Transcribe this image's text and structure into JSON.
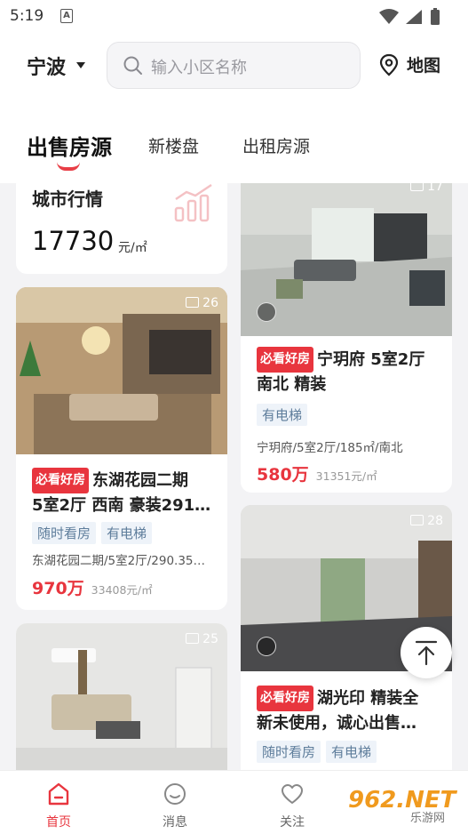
{
  "status_bar": {
    "time": "5:19"
  },
  "header": {
    "city": "宁波",
    "search_placeholder": "输入小区名称",
    "map_label": "地图",
    "tabs": [
      {
        "label": "出售房源",
        "active": true
      },
      {
        "label": "新楼盘",
        "active": false
      },
      {
        "label": "出租房源",
        "active": false
      }
    ]
  },
  "market": {
    "title": "城市行情",
    "price": "17730",
    "unit": "元/㎡"
  },
  "listings": [
    {
      "photo_count": "17",
      "badge": "必看好房",
      "title": "宁玥府 5室2厅南北 精装",
      "title_line1": "宁玥府 5室2厅",
      "title_line2": "南北 精装",
      "tags": [
        "有电梯"
      ],
      "meta": "宁玥府/5室2厅/185㎡/南北",
      "price": "580万",
      "unit_price": "31351元/㎡"
    },
    {
      "photo_count": "26",
      "badge": "必看好房",
      "title_line1": "东湖花园二期",
      "title_line2": "5室2厅 西南 豪装291…",
      "tags": [
        "随时看房",
        "有电梯"
      ],
      "meta": "东湖花园二期/5室2厅/290.35…",
      "price": "970万",
      "unit_price": "33408元/㎡"
    },
    {
      "photo_count": "28",
      "badge": "必看好房",
      "title_line1": "湖光印 精装全",
      "title_line2": "新未使用，诚心出售…",
      "tags": [
        "随时看房",
        "有电梯"
      ]
    },
    {
      "photo_count": "25"
    }
  ],
  "bottom_nav": [
    {
      "label": "首页",
      "active": true
    },
    {
      "label": "消息",
      "active": false
    },
    {
      "label": "关注",
      "active": false
    }
  ],
  "watermark": {
    "brand": "962.NET",
    "sub": "乐游网"
  },
  "colors": {
    "accent": "#e8353e",
    "tag_text": "#5e7d9b",
    "tag_bg": "#eef3f9"
  }
}
